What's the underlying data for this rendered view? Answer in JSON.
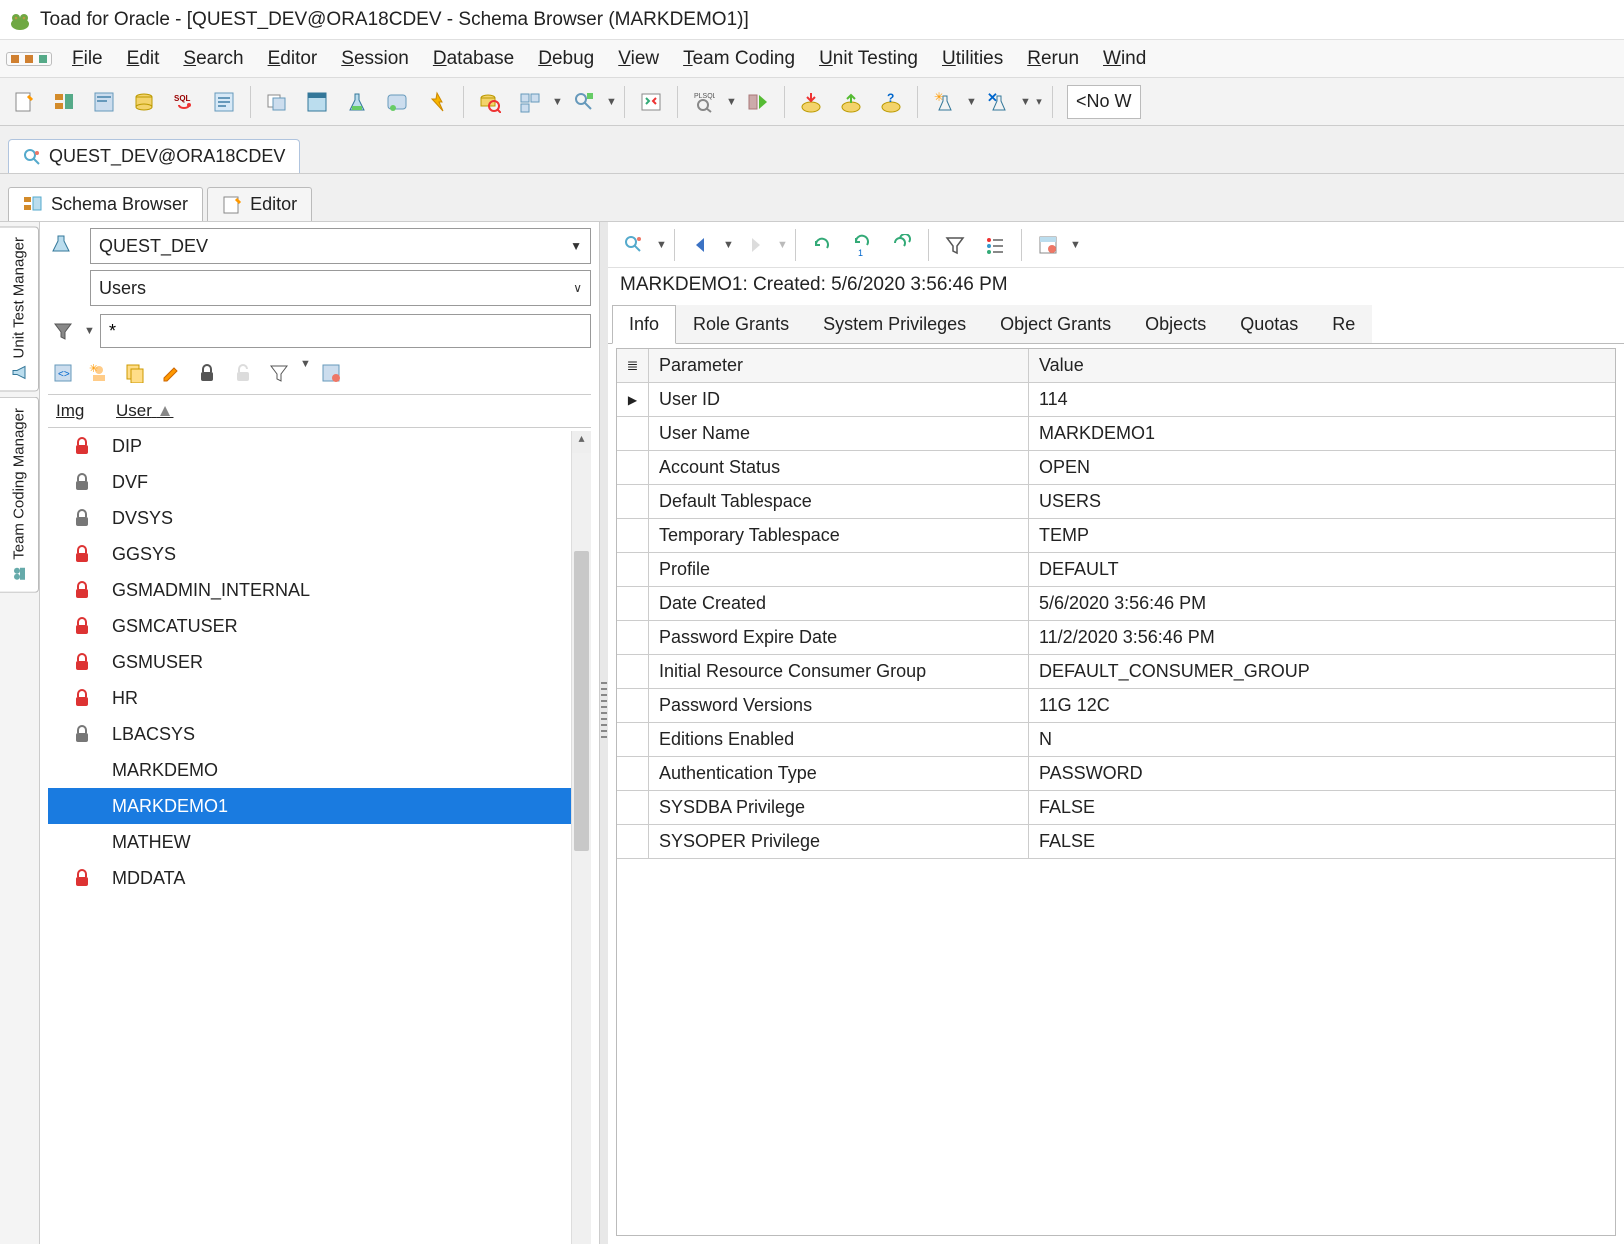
{
  "title": "Toad for Oracle - [QUEST_DEV@ORA18CDEV - Schema Browser (MARKDEMO1)]",
  "menus": [
    "File",
    "Edit",
    "Search",
    "Editor",
    "Session",
    "Database",
    "Debug",
    "View",
    "Team Coding",
    "Unit Testing",
    "Utilities",
    "Rerun",
    "Wind"
  ],
  "no_workspace": "<No W",
  "conn_tab": "QUEST_DEV@ORA18CDEV",
  "module_tabs": {
    "schema_browser": "Schema Browser",
    "editor": "Editor"
  },
  "vtabs": {
    "unit_test": "Unit Test Manager",
    "team_coding": "Team Coding Manager"
  },
  "left": {
    "schema": "QUEST_DEV",
    "object_type": "Users",
    "filter": "*",
    "columns": {
      "img": "Img",
      "user": "User"
    },
    "sort_glyph": "▲",
    "users": [
      {
        "icon": "red",
        "name": "DIP"
      },
      {
        "icon": "gray",
        "name": "DVF"
      },
      {
        "icon": "gray",
        "name": "DVSYS"
      },
      {
        "icon": "red",
        "name": "GGSYS"
      },
      {
        "icon": "red",
        "name": "GSMADMIN_INTERNAL"
      },
      {
        "icon": "red",
        "name": "GSMCATUSER"
      },
      {
        "icon": "red",
        "name": "GSMUSER"
      },
      {
        "icon": "red",
        "name": "HR"
      },
      {
        "icon": "gray",
        "name": "LBACSYS"
      },
      {
        "icon": "",
        "name": "MARKDEMO"
      },
      {
        "icon": "",
        "name": "MARKDEMO1",
        "selected": true
      },
      {
        "icon": "",
        "name": "MATHEW"
      },
      {
        "icon": "red",
        "name": "MDDATA"
      }
    ]
  },
  "detail": {
    "status": "MARKDEMO1:   Created: 5/6/2020 3:56:46 PM",
    "tabs": [
      "Info",
      "Role Grants",
      "System Privileges",
      "Object Grants",
      "Objects",
      "Quotas",
      "Re"
    ],
    "header": {
      "param": "Parameter",
      "value": "Value"
    },
    "rows": [
      {
        "p": "User ID",
        "v": "114",
        "active": true
      },
      {
        "p": "User Name",
        "v": "MARKDEMO1"
      },
      {
        "p": "Account Status",
        "v": "OPEN"
      },
      {
        "p": "Default Tablespace",
        "v": "USERS"
      },
      {
        "p": "Temporary Tablespace",
        "v": "TEMP"
      },
      {
        "p": "Profile",
        "v": "DEFAULT"
      },
      {
        "p": "Date Created",
        "v": "5/6/2020 3:56:46 PM"
      },
      {
        "p": "Password Expire Date",
        "v": "11/2/2020 3:56:46 PM"
      },
      {
        "p": "Initial Resource Consumer Group",
        "v": "DEFAULT_CONSUMER_GROUP"
      },
      {
        "p": "Password Versions",
        "v": "11G 12C"
      },
      {
        "p": "Editions Enabled",
        "v": "N"
      },
      {
        "p": "Authentication Type",
        "v": "PASSWORD"
      },
      {
        "p": "SYSDBA Privilege",
        "v": "FALSE"
      },
      {
        "p": "SYSOPER Privilege",
        "v": "FALSE"
      }
    ]
  }
}
